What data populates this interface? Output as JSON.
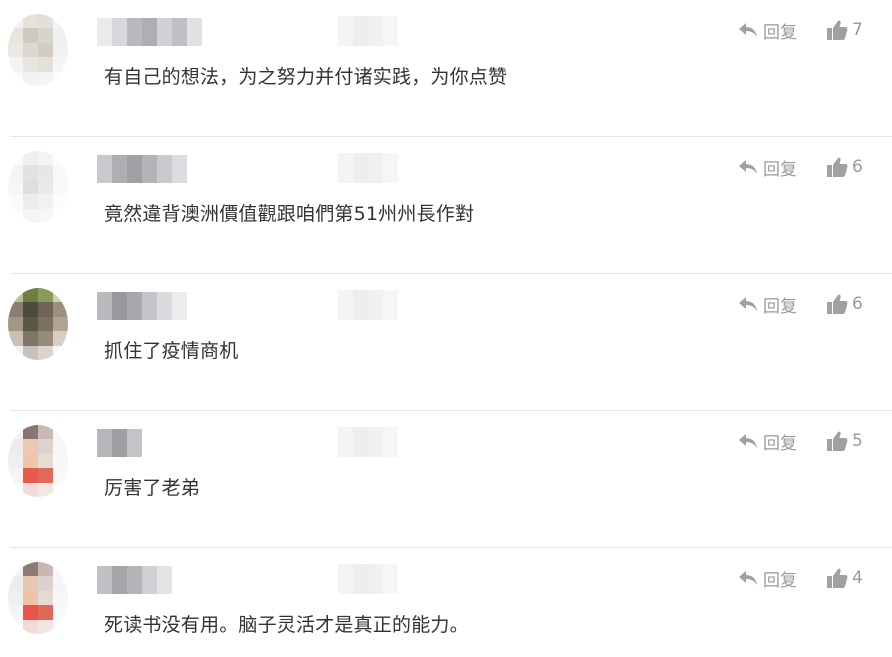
{
  "reply_label": "回复",
  "colors": {
    "text": "#333333",
    "meta": "#999999",
    "divider": "#e6e6e6"
  },
  "comments": [
    {
      "text": "有自己的想法，为之努力并付诸实践，为你点赞",
      "likes": "7",
      "avatar_pixels": [
        "#f2f2f2",
        "#e6e2da",
        "#e3ded8",
        "#f4f4f4",
        "#e8e4de",
        "#cfc9c2",
        "#d8d3cc",
        "#efefef",
        "#ece8e3",
        "#dcd7d0",
        "#d2ccc5",
        "#f1f1f1",
        "#f3f3f3",
        "#e8e5e0",
        "#e3dfd9",
        "#f5f5f5",
        "#fafafa",
        "#f2f2f2",
        "#f4f4f4",
        "#fbfbfb"
      ],
      "name_pixels": [
        "#e9eaec",
        "#d7d8db",
        "#b8b9bd",
        "#aeafb3",
        "#d0d1d5",
        "#bfc0c4",
        "#e0e1e4"
      ],
      "time_pixels": [
        "#f4f4f4",
        "#eeeeee",
        "#f0f0f0",
        "#f6f6f6"
      ]
    },
    {
      "text": "竟然違背澳洲價值觀跟咱們第51州州長作對",
      "likes": "6",
      "avatar_pixels": [
        "#fbfbfb",
        "#eeeeee",
        "#f3f3f3",
        "#fdfdfd",
        "#f4f4f4",
        "#e2e2e2",
        "#e7e7e7",
        "#f8f8f8",
        "#f6f6f6",
        "#dedede",
        "#e9e9e9",
        "#f9f9f9",
        "#fafafa",
        "#ececec",
        "#f1f1f1",
        "#fcfcfc",
        "#fdfdfd",
        "#f5f5f5",
        "#f7f7f7",
        "#fefefe"
      ],
      "name_pixels": [
        "#c8c9cc",
        "#aeafb2",
        "#9fa0a3",
        "#b3b4b7",
        "#c9cacd",
        "#dcdde0"
      ],
      "time_pixels": [
        "#f4f4f4",
        "#eeeeee",
        "#f0f0f0",
        "#f6f6f6"
      ]
    },
    {
      "text": "抓住了疫情商机",
      "likes": "6",
      "avatar_pixels": [
        "#b5c29a",
        "#6d7d44",
        "#8a9a5a",
        "#c9d2b3",
        "#8a7f70",
        "#4b4a3e",
        "#6e6356",
        "#9b8f80",
        "#a39684",
        "#5a5648",
        "#7c7060",
        "#b0a392",
        "#c8c0b4",
        "#807566",
        "#968a7a",
        "#d5cec4",
        "#f2f0ec",
        "#c9c2b8",
        "#dad4cb",
        "#f7f6f3"
      ],
      "name_pixels": [
        "#b9babd",
        "#98999c",
        "#a7a8ab",
        "#c4c5c8",
        "#dadbde",
        "#ececee"
      ],
      "time_pixels": [
        "#f4f4f4",
        "#eeeeee",
        "#f0f0f0",
        "#f6f6f6"
      ]
    },
    {
      "text": "厉害了老弟",
      "likes": "5",
      "avatar_pixels": [
        "#f3f3f3",
        "#8a7474",
        "#c9b9b6",
        "#f6f6f6",
        "#ececec",
        "#e9c9b4",
        "#dcd3cf",
        "#f5f5f5",
        "#efefef",
        "#f2c4a8",
        "#e6dcd6",
        "#f7f7f7",
        "#f4f4f4",
        "#e85a4a",
        "#e06a5a",
        "#f8f8f8",
        "#fafafa",
        "#f3dcd6",
        "#f4e6e2",
        "#fbfbfb"
      ],
      "name_pixels": [
        "#b6b7ba",
        "#9d9ea1",
        "#c3c4c7"
      ],
      "time_pixels": [
        "#f4f4f4",
        "#eeeeee",
        "#f0f0f0",
        "#f6f6f6"
      ]
    },
    {
      "text": "死读书没有用。脑子灵活才是真正的能力。",
      "likes": "4",
      "avatar_pixels": [
        "#f3f3f3",
        "#8f7a76",
        "#c7b8b4",
        "#f6f6f6",
        "#ececec",
        "#e7c8b3",
        "#dad2ce",
        "#f5f5f5",
        "#efefef",
        "#f0c3a7",
        "#e5dbd5",
        "#f7f7f7",
        "#f4f4f4",
        "#e6574a",
        "#df6858",
        "#f8f8f8",
        "#fafafa",
        "#f2dbd5",
        "#f3e5e1",
        "#fbfbfb"
      ],
      "name_pixels": [
        "#c0c1c4",
        "#a4a5a8",
        "#b3b4b7",
        "#cfd0d3",
        "#e3e4e6"
      ],
      "time_pixels": [
        "#f4f4f4",
        "#eeeeee",
        "#f0f0f0",
        "#f6f6f6"
      ]
    }
  ]
}
